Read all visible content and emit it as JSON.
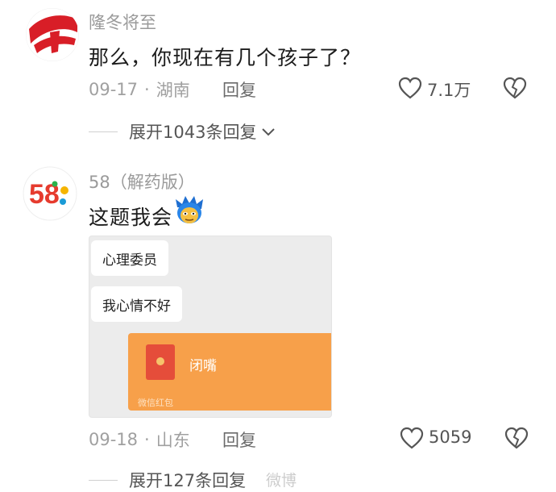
{
  "comments": [
    {
      "username": "隆冬将至",
      "text": "那么，你现在有几个孩子了？",
      "date": "09-17",
      "location": "湖南",
      "reply_label": "回复",
      "likes": "7.1万",
      "expand_label": "展开1043条回复"
    },
    {
      "username": "58（解药版）",
      "avatar_text": "58",
      "text": "这题我会",
      "emoji": "emoji-face",
      "date": "09-18",
      "location": "山东",
      "reply_label": "回复",
      "likes": "5059",
      "expand_label": "展开127条回复",
      "screenshot": {
        "bubble1": "心理委员",
        "bubble2": "我心情不好",
        "red_packet_title": "闭嘴",
        "red_packet_footer": "微信红包"
      }
    }
  ],
  "watermark": "微博",
  "colors": {
    "red_packet": "#f7a04a",
    "meta_grey": "#a0a0a0"
  }
}
